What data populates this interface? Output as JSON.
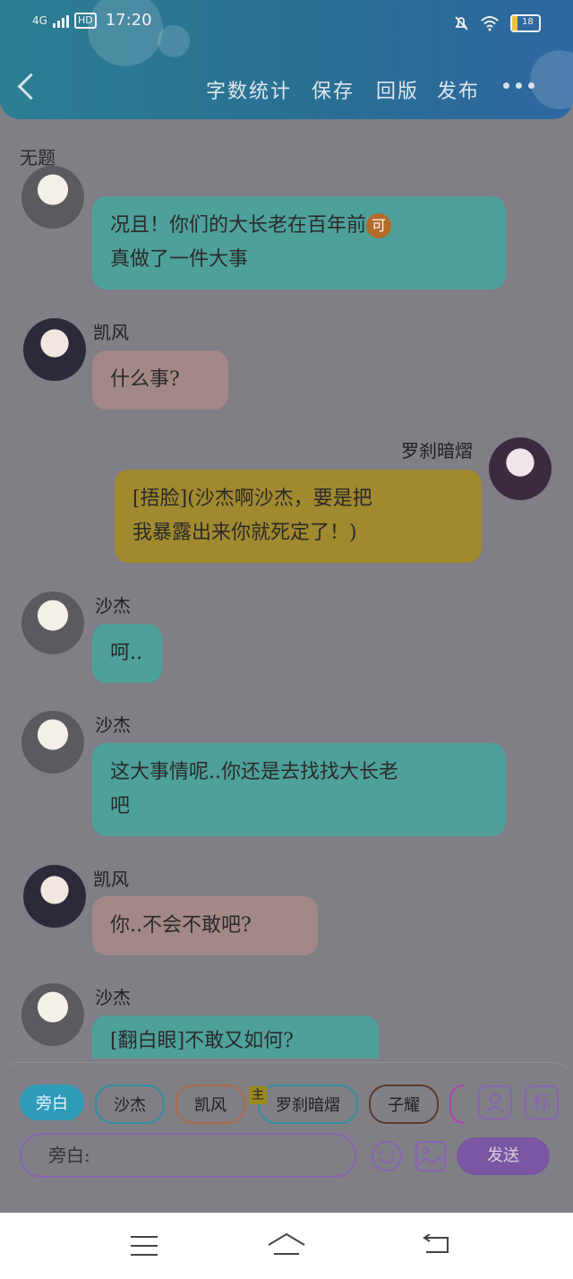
{
  "status_bar": {
    "network": "4G",
    "hd": "HD",
    "time": "17:20",
    "battery": "18"
  },
  "toolbar": {
    "word_count": "字数统计",
    "save": "保存",
    "rollback": "回版",
    "publish": "发布"
  },
  "doc": {
    "title": "无题"
  },
  "messages": [
    {
      "speaker": "",
      "text": "况且！你们的大长老在百年前",
      "text2": "真做了一件大事",
      "badge": "可"
    },
    {
      "speaker": "凯风",
      "text": "什么事?"
    },
    {
      "speaker": "罗刹暗熠",
      "text": "[捂脸](沙杰啊沙杰，要是把",
      "text2": "我暴露出来你就死定了！)"
    },
    {
      "speaker": "沙杰",
      "text": "呵.."
    },
    {
      "speaker": "沙杰",
      "text": "这大事情呢..你还是去找找大长老",
      "text2": "吧"
    },
    {
      "speaker": "凯风",
      "text": "你..不会不敢吧?"
    },
    {
      "speaker": "沙杰",
      "text": "[翻白眼]不敢又如何?"
    }
  ],
  "roles": {
    "narration": "旁白",
    "shajie": "沙杰",
    "kaifeng": "凯风",
    "luocha": "罗刹暗熠",
    "zhuo": "子耀",
    "main_tag": "主"
  },
  "input": {
    "placeholder": "旁白:",
    "send": "发送",
    "tag_button": "标"
  },
  "colors": {
    "teal_bubble": "#4ea19a",
    "pink_bubble": "#a38887",
    "yellow_bubble": "#a1892f",
    "accent": "#2f9bb9",
    "purple": "#7a55a1"
  }
}
